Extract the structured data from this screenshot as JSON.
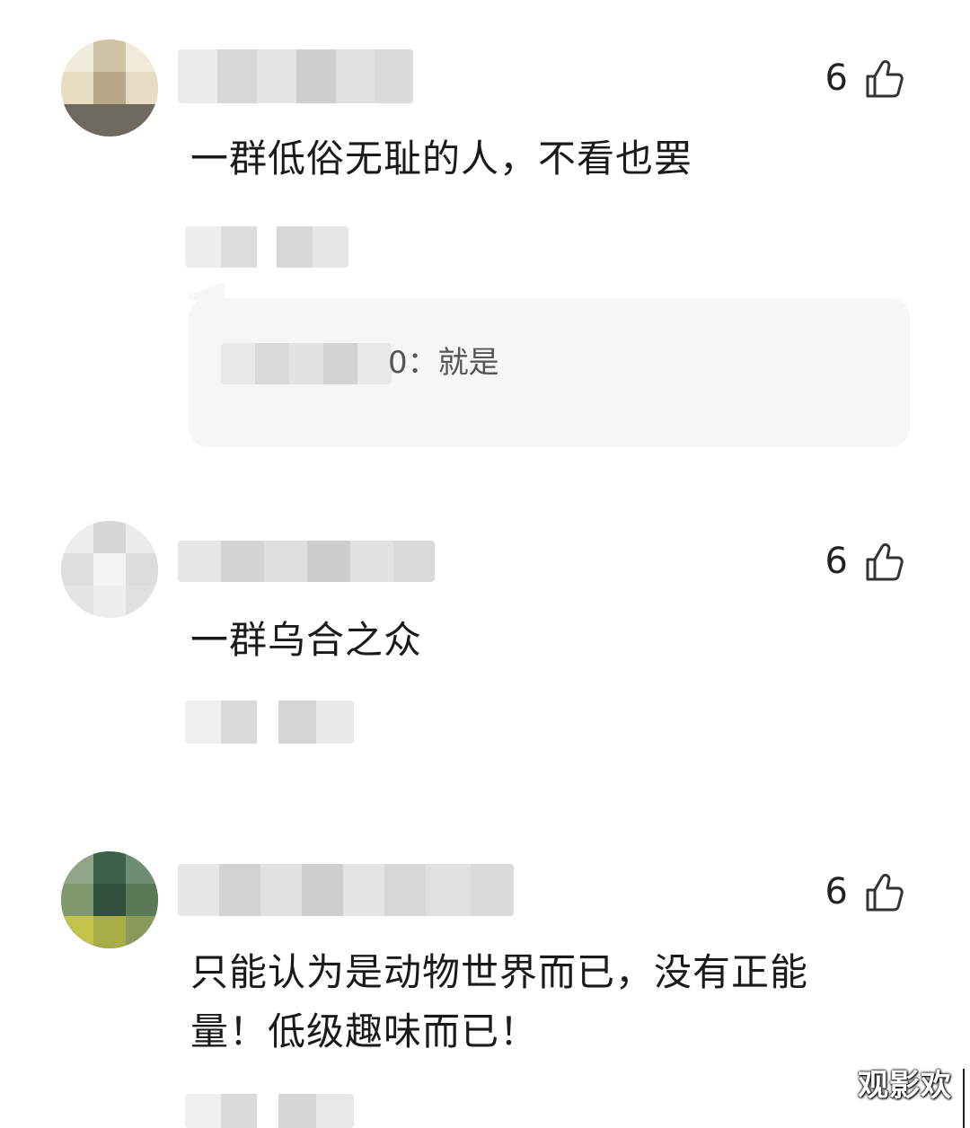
{
  "comments": [
    {
      "like_count": "6",
      "text": "一群低俗无耻的人，不看也罢",
      "reply": {
        "text": "0：就是"
      }
    },
    {
      "like_count": "6",
      "text": "一群乌合之众"
    },
    {
      "like_count": "6",
      "text_line1": "只能认为是动物世界而已，没有正能",
      "text_line2": "量！低级趣味而已！"
    }
  ],
  "watermark": "观影欢",
  "icons": {
    "like": "thumbs-up-icon"
  },
  "colors": {
    "background": "#ffffff",
    "reply_background": "#f6f6f6",
    "text": "#1a1a1a"
  }
}
